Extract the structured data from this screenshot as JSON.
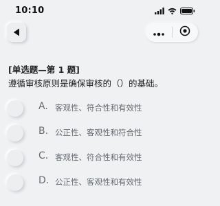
{
  "status_bar": {
    "time": "10:10",
    "icons": [
      "signal-icon",
      "wifi-icon",
      "battery-icon"
    ]
  },
  "nav": {
    "back_icon": "back-triangle-icon",
    "capsule_icons": [
      "more-dots-icon",
      "close-circle-icon"
    ]
  },
  "question": {
    "type_label": "[单选题—第 1 题]",
    "text": "遵循审核原则是确保审核的（）的基础。"
  },
  "options": [
    {
      "letter": "A.",
      "text": "客观性、符合性和有效性"
    },
    {
      "letter": "B.",
      "text": "公正性、客观性和符合性"
    },
    {
      "letter": "C.",
      "text": "客观性、符合性和有效性"
    },
    {
      "letter": "D.",
      "text": "公正性、客观性和有效性"
    }
  ],
  "colors": {
    "background": "#f0f1f3",
    "option_text": "#666a70",
    "question_text": "#222222"
  }
}
